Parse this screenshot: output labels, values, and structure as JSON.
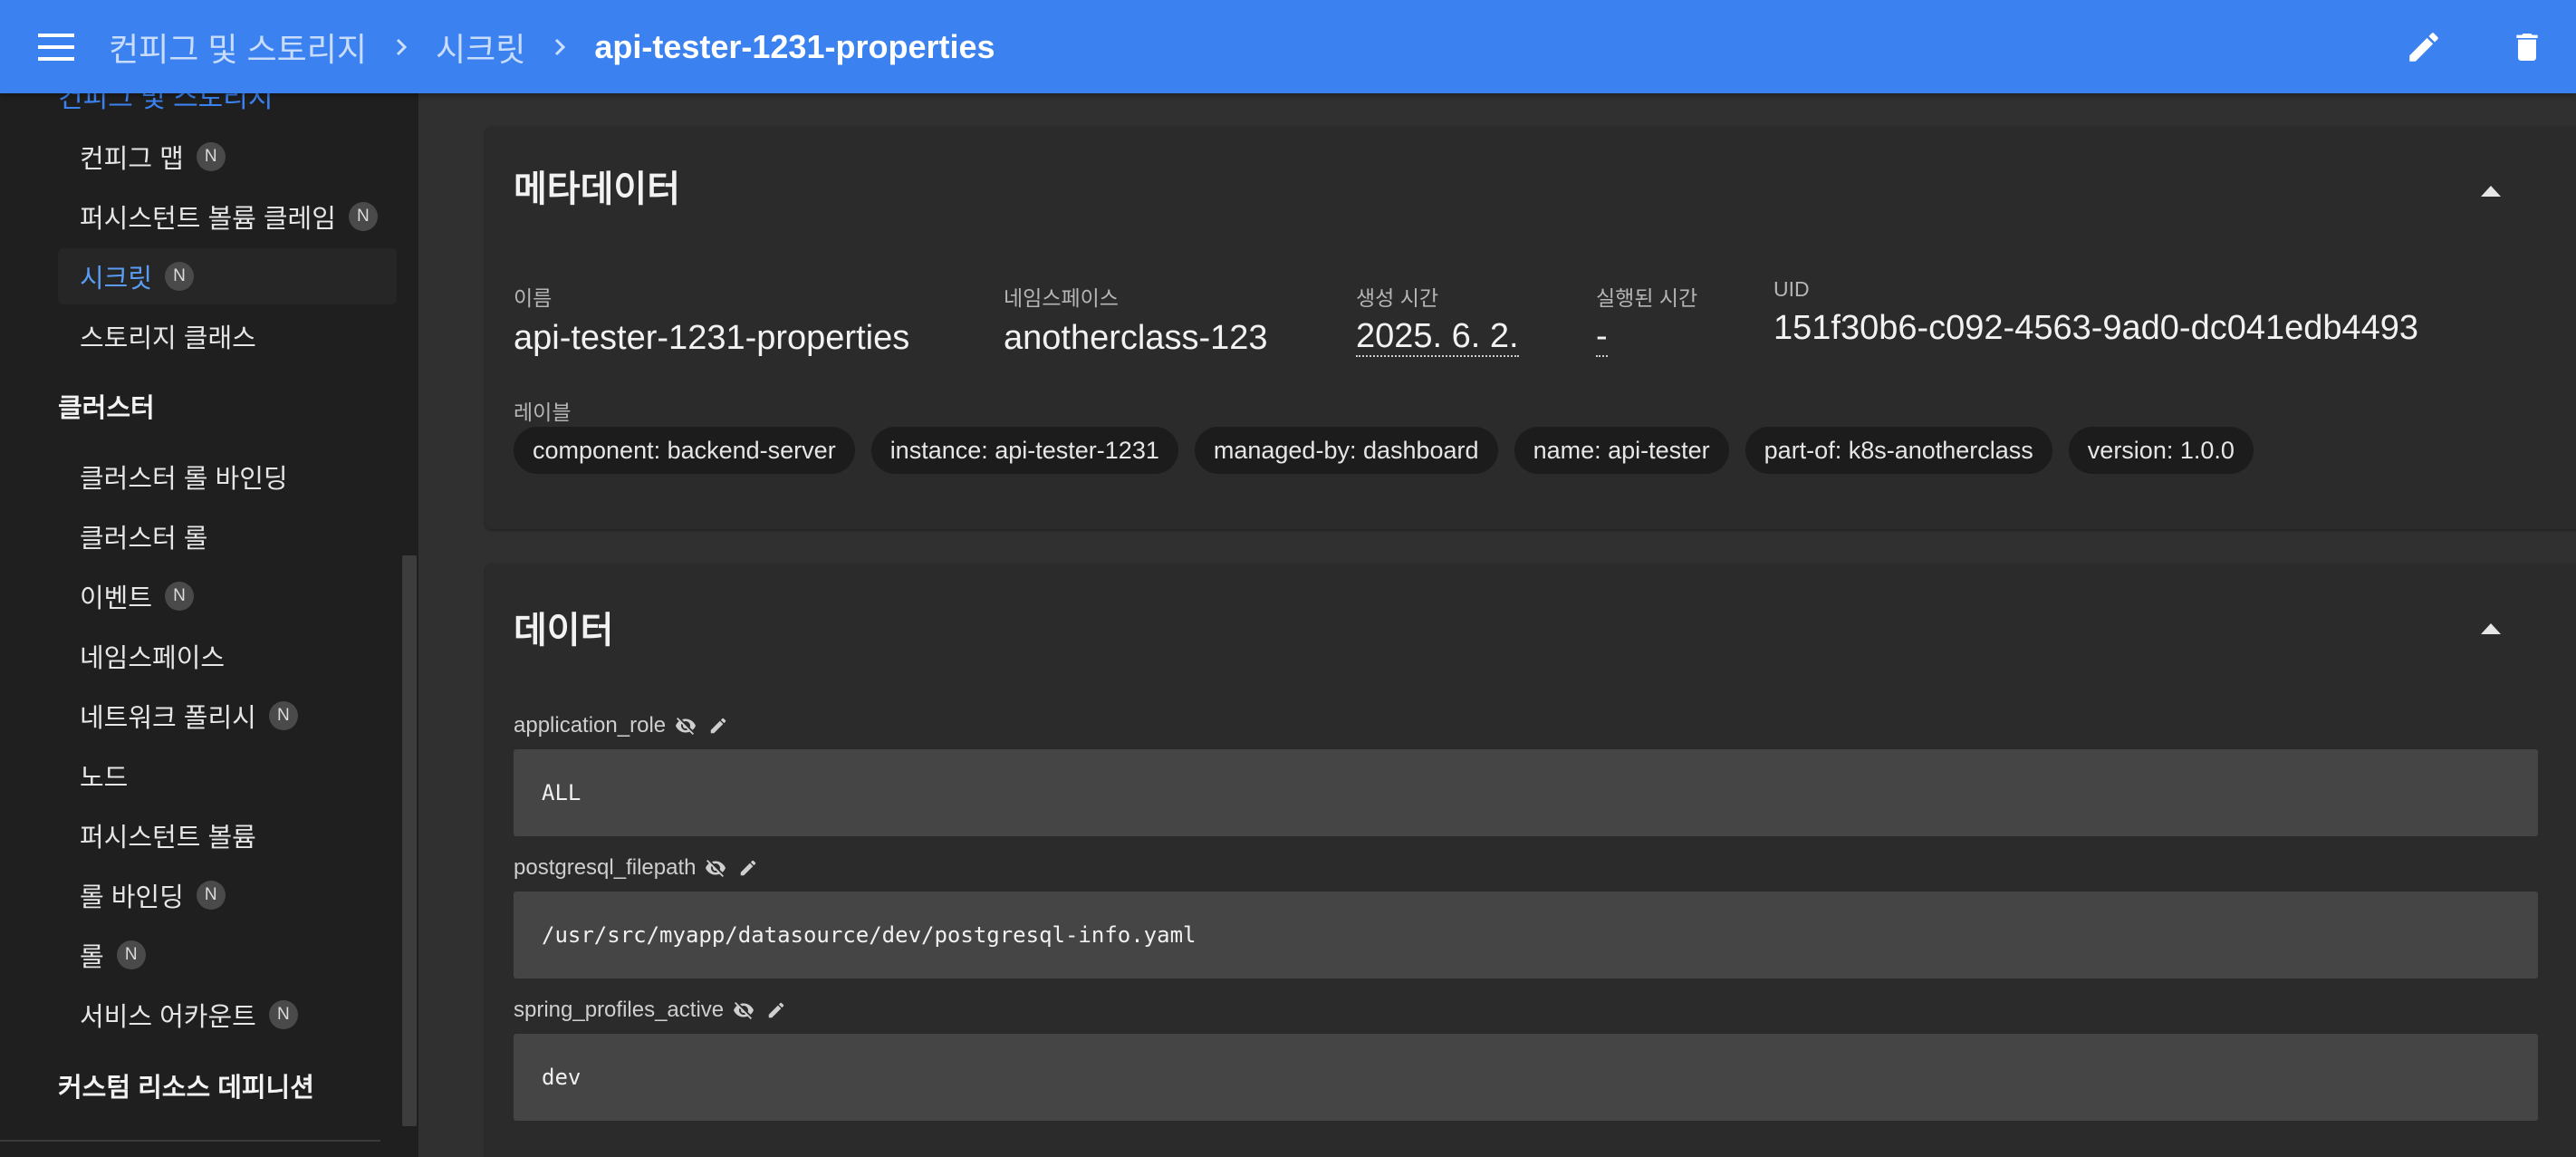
{
  "header": {
    "breadcrumbs": [
      "컨피그 및 스토리지",
      "시크릿"
    ],
    "current": "api-tester-1231-properties"
  },
  "sidebar": {
    "cut_item": "컨피그 및 스토리지",
    "items_top": [
      {
        "label": "컨피그 맵",
        "badge": "N"
      },
      {
        "label": "퍼시스턴트 볼륨 클레임",
        "badge": "N"
      },
      {
        "label": "시크릿",
        "badge": "N",
        "active": true
      },
      {
        "label": "스토리지 클래스",
        "badge": ""
      }
    ],
    "group_cluster": "클러스터",
    "items_cluster": [
      {
        "label": "클러스터 롤 바인딩",
        "badge": ""
      },
      {
        "label": "클러스터 롤",
        "badge": ""
      },
      {
        "label": "이벤트",
        "badge": "N"
      },
      {
        "label": "네임스페이스",
        "badge": ""
      },
      {
        "label": "네트워크 폴리시",
        "badge": "N"
      },
      {
        "label": "노드",
        "badge": ""
      },
      {
        "label": "퍼시스턴트 볼륨",
        "badge": ""
      },
      {
        "label": "롤 바인딩",
        "badge": "N"
      },
      {
        "label": "롤",
        "badge": "N"
      },
      {
        "label": "서비스 어카운트",
        "badge": "N"
      }
    ],
    "group_crd": "커스텀 리소스 데피니션"
  },
  "metadata": {
    "title": "메타데이터",
    "name_label": "이름",
    "name_value": "api-tester-1231-properties",
    "namespace_label": "네임스페이스",
    "namespace_value": "anotherclass-123",
    "created_label": "생성 시간",
    "created_value": "2025. 6. 2.",
    "age_label": "실행된 시간",
    "age_value": "-",
    "uid_label": "UID",
    "uid_value": "151f30b6-c092-4563-9ad0-dc041edb4493",
    "labels_title": "레이블",
    "labels": [
      "component: backend-server",
      "instance: api-tester-1231",
      "managed-by: dashboard",
      "name: api-tester",
      "part-of: k8s-anotherclass",
      "version: 1.0.0"
    ]
  },
  "data": {
    "title": "데이터",
    "entries": [
      {
        "key": "application_role",
        "value": "ALL"
      },
      {
        "key": "postgresql_filepath",
        "value": "/usr/src/myapp/datasource/dev/postgresql-info.yaml"
      },
      {
        "key": "spring_profiles_active",
        "value": "dev"
      }
    ]
  },
  "icons": {
    "menu": "menu-icon",
    "chevron": "chevron-right-icon",
    "edit": "pencil-icon",
    "delete": "trash-icon",
    "collapse": "caret-up-icon",
    "hide": "eye-off-icon"
  },
  "colors": {
    "appbar": "#3b82f0",
    "accent": "#5b9cf5",
    "background": "#303030",
    "sidebar": "#1f1f1f",
    "card": "#2b2b2b"
  }
}
